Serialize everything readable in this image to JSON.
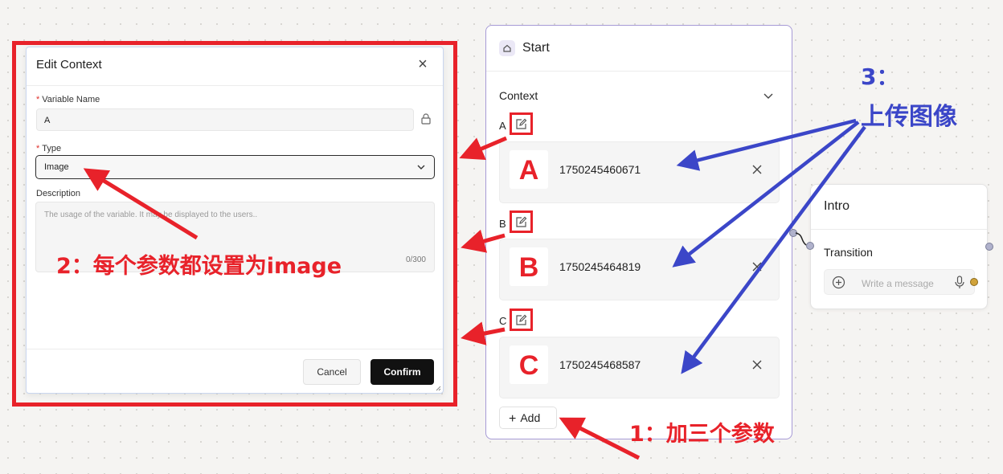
{
  "dialog": {
    "title": "Edit Context",
    "close_icon": "close-icon",
    "variable_name_label": "Variable Name",
    "variable_name_value": "A",
    "type_label": "Type",
    "type_value": "Image",
    "description_label": "Description",
    "description_placeholder": "The usage of the variable. It may be displayed to the users..",
    "counter": "0/300",
    "cancel_label": "Cancel",
    "confirm_label": "Confirm",
    "required_mark": "*"
  },
  "start_node": {
    "title": "Start",
    "context_label": "Context",
    "variables": [
      {
        "letter": "A",
        "thumb": "A",
        "file": "1750245460671"
      },
      {
        "letter": "B",
        "thumb": "B",
        "file": "1750245464819"
      },
      {
        "letter": "C",
        "thumb": "C",
        "file": "1750245468587"
      }
    ],
    "add_label": "Add",
    "add_symbol": "+"
  },
  "intro_node": {
    "title": "Intro",
    "transition_label": "Transition",
    "message_placeholder": "Write a message"
  },
  "annotations": {
    "step1": "1：加三个参数",
    "step2": "2：每个参数都设置为image",
    "step3_num": "3：",
    "step3_text": "上传图像"
  },
  "colors": {
    "highlight_red": "#e8222a",
    "annotation_blue": "#3b46c8",
    "node_border": "#a79bd6",
    "confirm_bg": "#111111",
    "port_gold": "#d1a33a"
  }
}
